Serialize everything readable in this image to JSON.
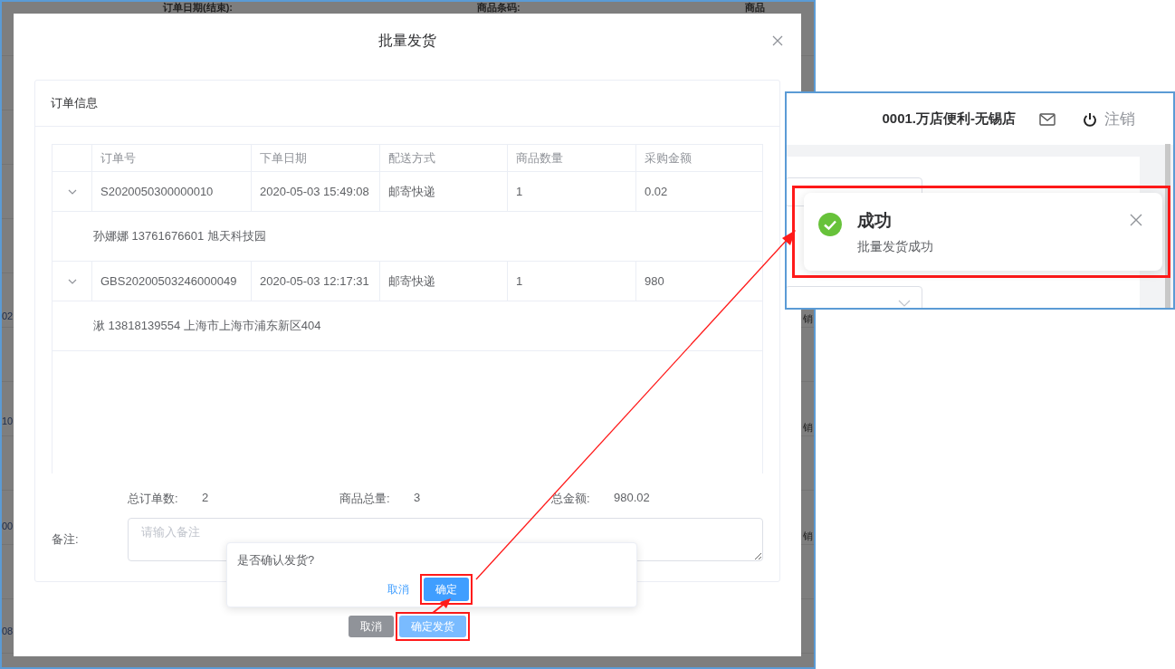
{
  "background": {
    "labels": [
      "订单日期(结束):",
      "商品条码:",
      "商品"
    ],
    "left_fragments": [
      "02",
      "10",
      "00",
      "08"
    ],
    "right_fragments": [
      "销",
      "销",
      "销"
    ]
  },
  "dialog": {
    "title": "批量发货",
    "card_title": "订单信息",
    "table": {
      "columns": [
        "订单号",
        "下单日期",
        "配送方式",
        "商品数量",
        "采购金额"
      ],
      "rows": [
        {
          "expanded": true,
          "cells": [
            "S2020050300000010",
            "2020-05-03 15:49:08",
            "邮寄快递",
            "1",
            "0.02"
          ],
          "detail": "孙娜娜 13761676601 旭天科技园"
        },
        {
          "expanded": true,
          "cells": [
            "GBS20200503246000049",
            "2020-05-03 12:17:31",
            "邮寄快递",
            "1",
            "980"
          ],
          "detail": "湫 13818139554 上海市上海市浦东新区404"
        }
      ]
    },
    "summary": [
      {
        "label": "总订单数:",
        "value": "2"
      },
      {
        "label": "商品总量:",
        "value": "3"
      },
      {
        "label": "总金额:",
        "value": "980.02"
      }
    ],
    "remark": {
      "label": "备注:",
      "placeholder": "请输入备注"
    },
    "buttons": [
      {
        "label": "取消",
        "kind": "secondary",
        "highlighted": false
      },
      {
        "label": "确定发货",
        "kind": "primary",
        "highlighted": true
      }
    ]
  },
  "popconfirm": {
    "message": "是否确认发货?",
    "buttons": [
      {
        "label": "取消",
        "kind": "link",
        "highlighted": false
      },
      {
        "label": "确定",
        "kind": "primary",
        "highlighted": true
      }
    ]
  },
  "zoom_panel": {
    "store": "0001.万店便利-无锡店",
    "logout": "注销",
    "toast": {
      "title": "成功",
      "message": "批量发货成功",
      "highlighted": true
    }
  }
}
